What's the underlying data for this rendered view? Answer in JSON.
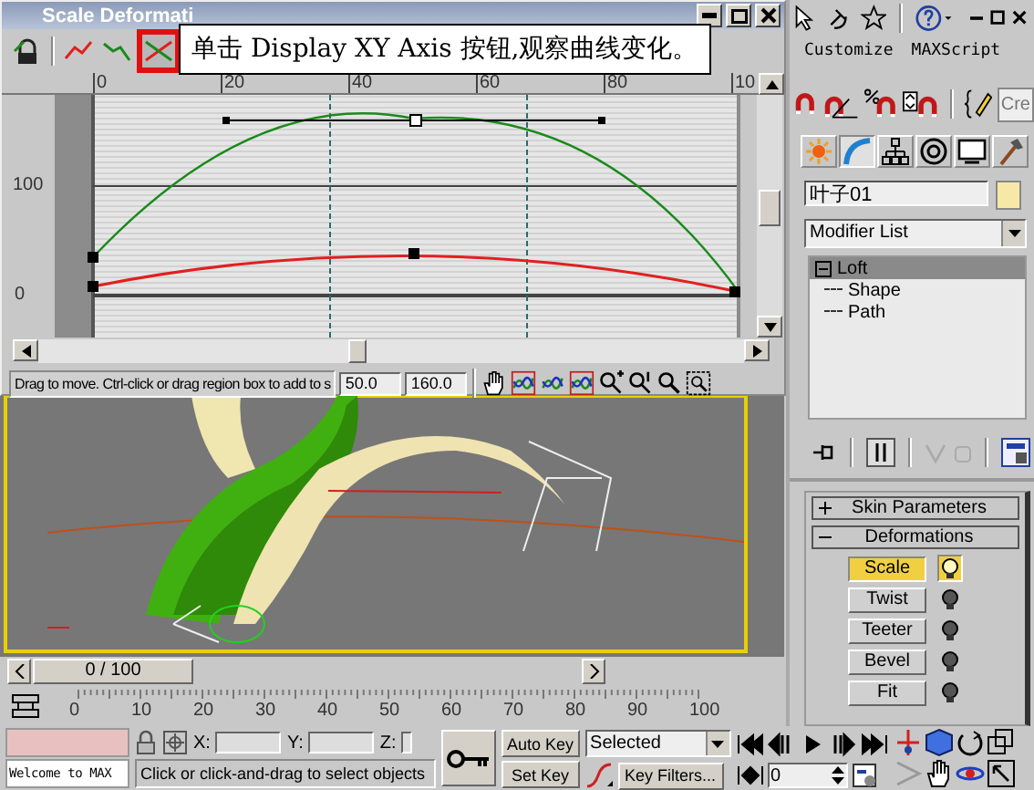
{
  "dialog": {
    "title": "Scale Deformati",
    "toolbar": [
      {
        "kind": "lock",
        "selected": false,
        "highlighted": false
      },
      {
        "kind": "curve-x",
        "selected": false,
        "highlighted": false
      },
      {
        "kind": "curve-y",
        "selected": false,
        "highlighted": false
      },
      {
        "kind": "curve-xy",
        "selected": true,
        "highlighted": true
      }
    ],
    "callout": "单击 Display XY Axis 按钮,观察曲线变化。",
    "ruler": [
      "0",
      "20",
      "40",
      "60",
      "80",
      "10"
    ],
    "y_labels": [
      "100",
      "0"
    ],
    "prompt": "Drag to move. Ctrl-click or drag region box to add to s",
    "fields": [
      "50.0",
      "160.0"
    ]
  },
  "menu": [
    "Customize",
    "MAXScript"
  ],
  "selection_set": "Cre",
  "command_tabs": [
    {
      "kind": "create",
      "selected": false
    },
    {
      "kind": "modify",
      "selected": true
    },
    {
      "kind": "hierarchy",
      "selected": false
    },
    {
      "kind": "motion",
      "selected": false
    },
    {
      "kind": "display",
      "selected": false
    },
    {
      "kind": "utilities",
      "selected": false
    }
  ],
  "object_name": "叶子01",
  "modifier_list": "Modifier List",
  "stack": [
    {
      "label": "Loft",
      "expanded": true,
      "selected": true,
      "children": [
        {
          "label": "Shape"
        },
        {
          "label": "Path"
        }
      ]
    }
  ],
  "rollouts": [
    {
      "title": "Skin Parameters",
      "expanded": false
    },
    {
      "title": "Deformations",
      "expanded": true,
      "buttons": [
        {
          "label": "Scale",
          "selected": true,
          "on": true
        },
        {
          "label": "Twist",
          "selected": false,
          "on": false
        },
        {
          "label": "Teeter",
          "selected": false,
          "on": false
        },
        {
          "label": "Bevel",
          "selected": false,
          "on": false
        },
        {
          "label": "Fit",
          "selected": false,
          "on": false
        }
      ]
    }
  ],
  "time_slider": "0 / 100",
  "track_ticks": [
    "0",
    "10",
    "20",
    "30",
    "40",
    "50",
    "60",
    "70",
    "80",
    "90",
    "100"
  ],
  "listener": "Welcome to MAX",
  "coords": [
    {
      "label": "X:"
    },
    {
      "label": "Y:"
    },
    {
      "label": "Z:"
    }
  ],
  "status_prompt": "Click or click-and-drag to select objects",
  "auto_key": {
    "label": "Auto Key",
    "on": false
  },
  "set_key": "Set Key",
  "key_mode": "Selected",
  "key_filters": "Key Filters...",
  "frame": "0"
}
